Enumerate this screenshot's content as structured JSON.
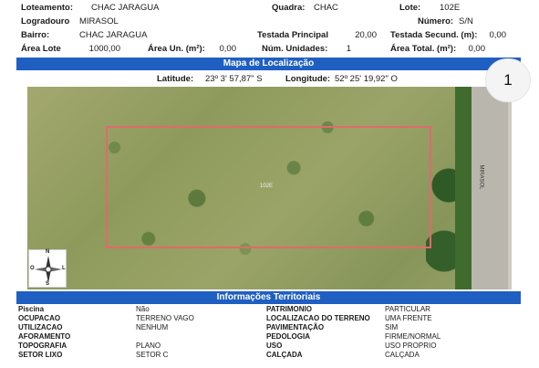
{
  "header": {
    "loteamento_label": "Loteamento:",
    "loteamento": "CHAC JARAGUA",
    "quadra_label": "Quadra:",
    "quadra": "CHAC",
    "lote_label": "Lote:",
    "lote": "102E",
    "logradouro_label": "Logradouro",
    "logradouro": "MIRASOL",
    "numero_label": "Número:",
    "numero": "S/N",
    "bairro_label": "Bairro:",
    "bairro": "CHAC JARAGUA",
    "testada_principal_label": "Testada Principal",
    "testada_principal": "20,00",
    "testada_secund_label": "Testada Secund. (m):",
    "testada_secund": "0,00",
    "area_lote_label": "Área Lote",
    "area_lote": "1000,00",
    "area_un_label": "Área Un. (m²):",
    "area_un": "0,00",
    "num_unidades_label": "Núm. Unidades:",
    "num_unidades": "1",
    "area_total_label": "Área Total. (m²):",
    "area_total": "0,00"
  },
  "mapa": {
    "title": "Mapa de Localização",
    "latitude_label": "Latitude:",
    "latitude": "23º 3' 57,87\" S",
    "longitude_label": "Longitude:",
    "longitude": "52º 25' 19,92\" O",
    "lot_label": "102E",
    "road_label": "MIRASOL",
    "page_number": "1",
    "compass": {
      "n": "N",
      "s": "S",
      "l": "L",
      "o": "O"
    }
  },
  "info": {
    "title": "Informações Territoriais",
    "rows": [
      {
        "l1": "Piscina",
        "v1": "Não",
        "l2": "PATRIMONIO",
        "v2": "PARTICULAR"
      },
      {
        "l1": "OCUPACAO",
        "v1": "TERRENO VAGO",
        "l2": "LOCALIZACAO DO TERRENO",
        "v2": "UMA FRENTE"
      },
      {
        "l1": "UTILIZACAO",
        "v1": "NENHUM",
        "l2": "PAVIMENTAÇÃO",
        "v2": "SIM"
      },
      {
        "l1": "AFORAMENTO",
        "v1": "",
        "l2": "PEDOLOGIA",
        "v2": "FIRME/NORMAL"
      },
      {
        "l1": "TOPOGRAFIA",
        "v1": "PLANO",
        "l2": "USO",
        "v2": "USO PROPRIO"
      },
      {
        "l1": "SETOR LIXO",
        "v1": "SETOR C",
        "l2": "CALÇADA",
        "v2": "CALÇADA"
      }
    ]
  }
}
